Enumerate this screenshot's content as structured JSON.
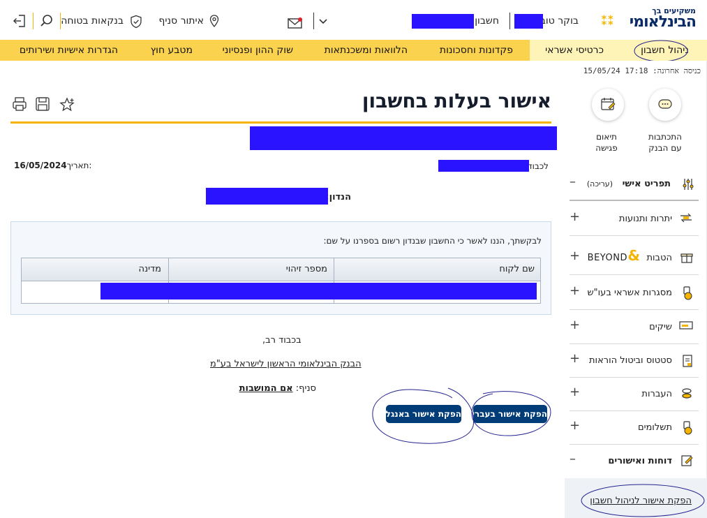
{
  "brand": {
    "tagline": "משקיעים בך",
    "name": "הבינלאומי"
  },
  "header": {
    "greeting": "בוקר טוב",
    "account_label": "חשבון",
    "branch_locator": "איתור סניף",
    "secure_banking": "בנקאות בטוחה"
  },
  "nav": {
    "items": [
      "ניהול חשבון",
      "כרטיסי אשראי",
      "פקדונות וחסכונות",
      "הלוואות ומשכנתאות",
      "שוק ההון ופנסיוני",
      "מטבע חוץ",
      "הגדרות אישיות ושירותים"
    ]
  },
  "sidebar": {
    "last_login_label": "כניסה אחרונה:",
    "last_login_value": "17:18 15/05/24",
    "quick_actions": [
      {
        "label_line1": "התכתבות",
        "label_line2": "עם הבנק",
        "icon": "chat-icon"
      },
      {
        "label_line1": "תיאום",
        "label_line2": "פגישה",
        "icon": "calendar-icon"
      }
    ],
    "personal_menu": "תפריט אישי",
    "edit_label": "(עריכה)",
    "items": [
      {
        "label": "יתרות ותנועות",
        "icon": "transactions-icon"
      },
      {
        "label": "הטבות",
        "extra": "BEYOND",
        "icon": "gift-icon"
      },
      {
        "label": "מסגרות אשראי בעו\"ש",
        "icon": "credit-limit-icon"
      },
      {
        "label": "שיקים",
        "icon": "checks-icon"
      },
      {
        "label": "סטטוס וביטול הוראות",
        "icon": "instructions-icon"
      },
      {
        "label": "העברות",
        "icon": "transfers-icon"
      },
      {
        "label": "תשלומים",
        "icon": "payments-icon"
      },
      {
        "label": "דוחות ואישורים",
        "icon": "reports-icon"
      }
    ],
    "sub_link": "הפקת אישור לניהול חשבון"
  },
  "main": {
    "title": "אישור בעלות בחשבון",
    "to_label": "לכבוד",
    "date_label": "תאריך:",
    "date_value": "16/05/2024",
    "subject_label": "הנדון:",
    "body_text": "לבקשתך, הננו לאשר כי החשבון שבנדון רשום בספרנו על שם:",
    "table_headers": [
      "שם לקוח",
      "מספר זיהוי",
      "מדינה"
    ],
    "closing": "בכבוד רב,",
    "bank_name": "הבנק הבינלאומי הראשון לישראל בע\"מ",
    "branch_label": "סניף:",
    "branch_value": "אם המושבות",
    "btn_hebrew": "הפקת אישור בעברית",
    "btn_english": "הפקת אישור באנגלית"
  },
  "colors": {
    "nav_bg": "#fbd24e",
    "accent_gold": "#f5b400",
    "button_blue": "#003c78",
    "brand_navy": "#0a2a66"
  }
}
